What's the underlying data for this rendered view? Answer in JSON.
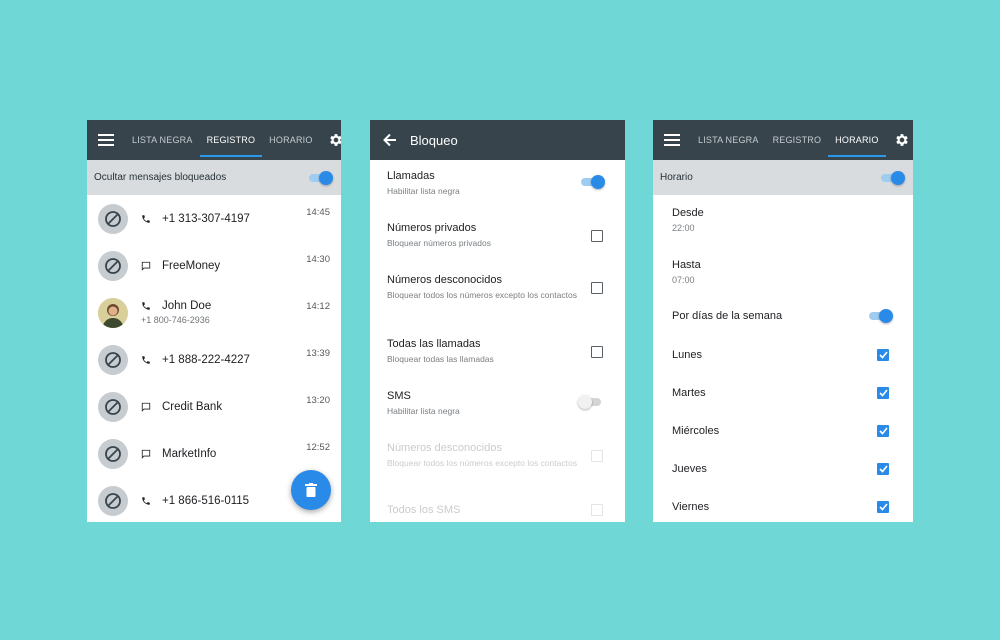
{
  "colors": {
    "background": "#6fd7d6",
    "appbar": "#37444c",
    "accent": "#2a8ae8"
  },
  "screen1": {
    "tabs": [
      "LISTA NEGRA",
      "REGISTRO",
      "HORARIO"
    ],
    "active_tab": "REGISTRO",
    "hide_label": "Ocultar mensajes bloqueados",
    "hide_enabled": true,
    "log": [
      {
        "type": "call",
        "title": "+1 313-307-4197",
        "time": "14:45",
        "avatar": "blocked"
      },
      {
        "type": "message",
        "title": "FreeMoney",
        "time": "14:30",
        "avatar": "blocked"
      },
      {
        "type": "call",
        "title": "John Doe",
        "subtitle": "+1 800-746-2936",
        "time": "14:12",
        "avatar": "photo"
      },
      {
        "type": "call",
        "title": "+1 888-222-4227",
        "time": "13:39",
        "avatar": "blocked"
      },
      {
        "type": "message",
        "title": "Credit Bank",
        "time": "13:20",
        "avatar": "blocked"
      },
      {
        "type": "message",
        "title": "MarketInfo",
        "time": "12:52",
        "avatar": "blocked"
      },
      {
        "type": "call",
        "title": "+1 866-516-0115",
        "time": "",
        "avatar": "blocked"
      }
    ],
    "fab_icon": "trash-icon"
  },
  "screen2": {
    "title": "Bloqueo",
    "settings": [
      {
        "title": "Llamadas",
        "subtitle": "Habilitar lista negra",
        "control": "toggle",
        "on": true,
        "disabled": false
      },
      {
        "title": "Números privados",
        "subtitle": "Bloquear números privados",
        "control": "checkbox",
        "on": false,
        "disabled": false
      },
      {
        "title": "Números desconocidos",
        "subtitle": "Bloquear todos los números excepto los contactos",
        "control": "checkbox",
        "on": false,
        "disabled": false
      },
      {
        "title": "Todas las llamadas",
        "subtitle": "Bloquear todas las llamadas",
        "control": "checkbox",
        "on": false,
        "disabled": false
      },
      {
        "title": "SMS",
        "subtitle": "Habilitar lista negra",
        "control": "toggle",
        "on": false,
        "disabled": false
      },
      {
        "title": "Números desconocidos",
        "subtitle": "Bloquear todos los números excepto los contactos",
        "control": "checkbox",
        "on": false,
        "disabled": true
      },
      {
        "title": "Todos los SMS",
        "subtitle": "",
        "control": "checkbox",
        "on": false,
        "disabled": true
      }
    ]
  },
  "screen3": {
    "tabs": [
      "LISTA NEGRA",
      "REGISTRO",
      "HORARIO"
    ],
    "active_tab": "HORARIO",
    "header_label": "Horario",
    "header_enabled": true,
    "from_label": "Desde",
    "from_value": "22:00",
    "to_label": "Hasta",
    "to_value": "07:00",
    "by_days_label": "Por días de la semana",
    "by_days_enabled": true,
    "days": [
      {
        "name": "Lunes",
        "checked": true
      },
      {
        "name": "Martes",
        "checked": true
      },
      {
        "name": "Miércoles",
        "checked": true
      },
      {
        "name": "Jueves",
        "checked": true
      },
      {
        "name": "Viernes",
        "checked": true
      }
    ]
  }
}
